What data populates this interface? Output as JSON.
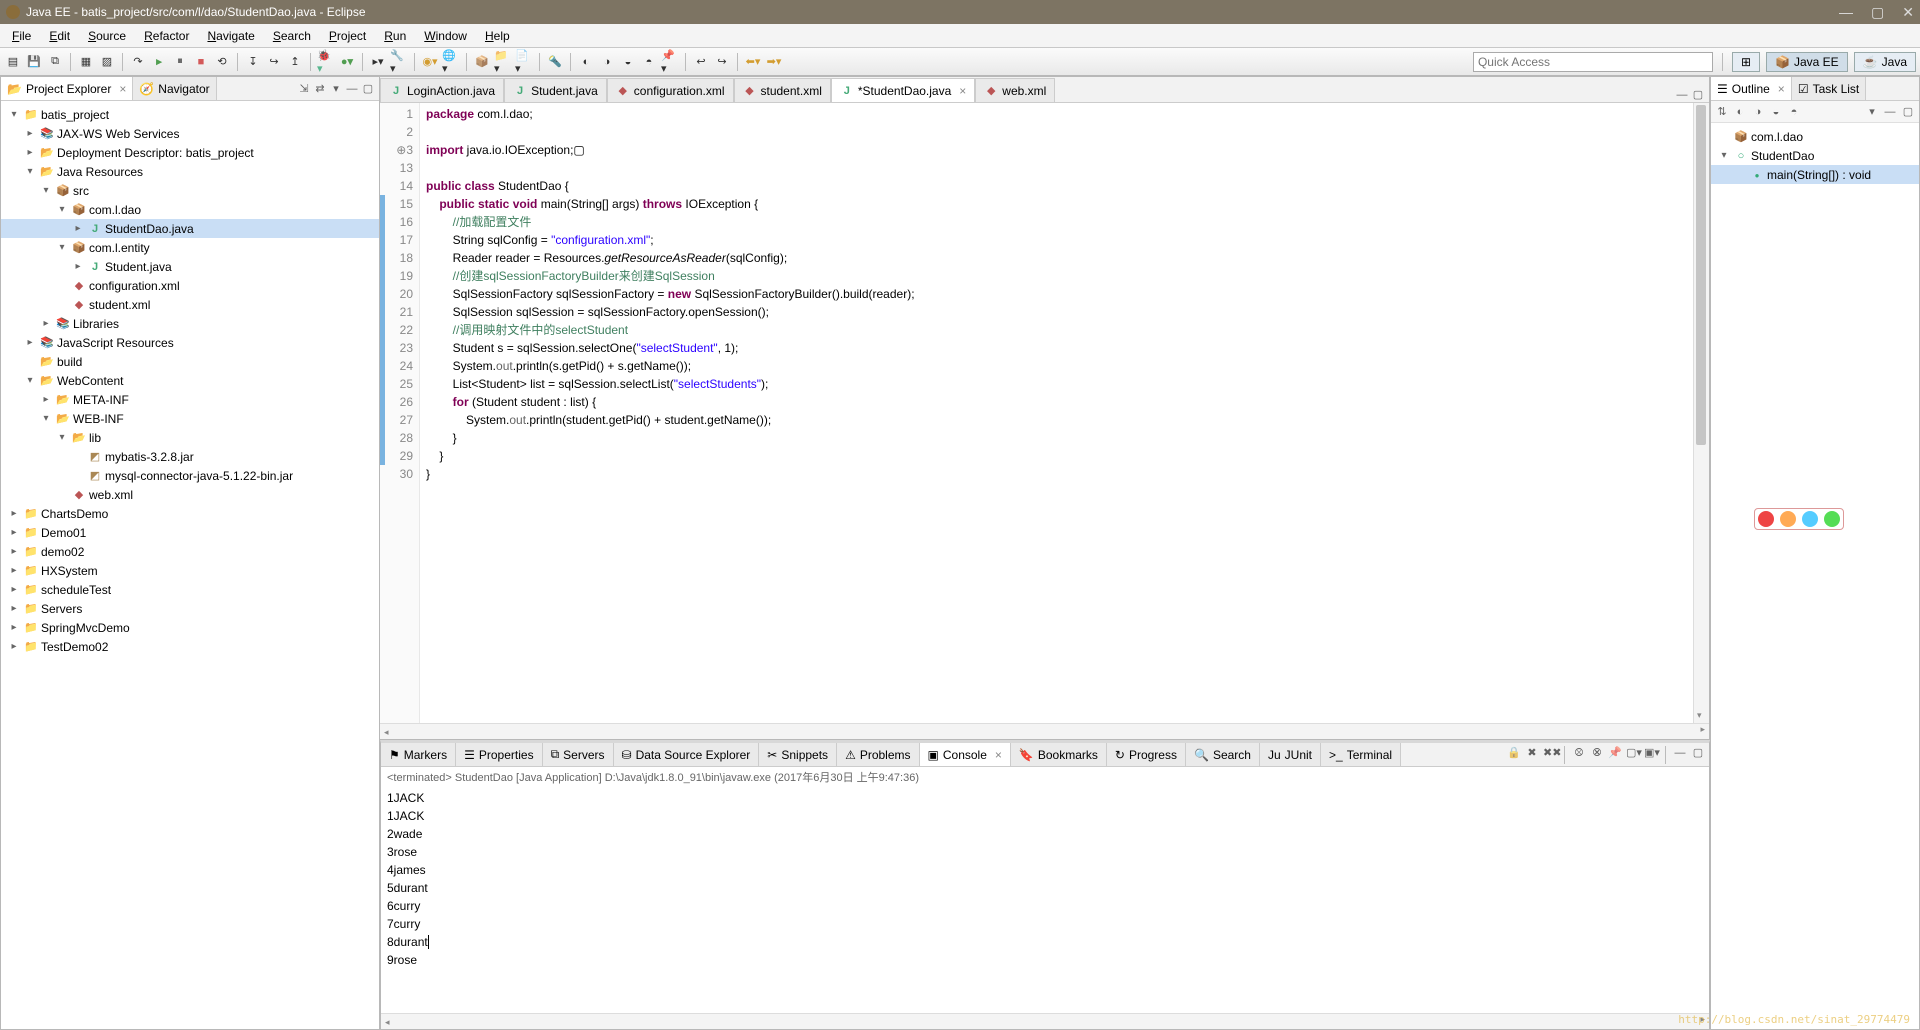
{
  "title": "Java EE - batis_project/src/com/l/dao/StudentDao.java - Eclipse",
  "menus": [
    "File",
    "Edit",
    "Source",
    "Refactor",
    "Navigate",
    "Search",
    "Project",
    "Run",
    "Window",
    "Help"
  ],
  "quick_access_ph": "Quick Access",
  "perspectives": [
    "Java EE",
    "Java"
  ],
  "left_tabs": {
    "a": "Project Explorer",
    "b": "Navigator"
  },
  "project_tree": [
    {
      "d": 0,
      "tw": "▾",
      "i": "ico-prj",
      "t": "batis_project"
    },
    {
      "d": 1,
      "tw": "▸",
      "i": "ico-lib",
      "t": "JAX-WS Web Services"
    },
    {
      "d": 1,
      "tw": "▸",
      "i": "ico-fld",
      "t": "Deployment Descriptor: batis_project"
    },
    {
      "d": 1,
      "tw": "▾",
      "i": "ico-fld",
      "t": "Java Resources"
    },
    {
      "d": 2,
      "tw": "▾",
      "i": "ico-pkg",
      "t": "src"
    },
    {
      "d": 3,
      "tw": "▾",
      "i": "ico-pkg",
      "t": "com.l.dao"
    },
    {
      "d": 4,
      "tw": "▸",
      "i": "ico-java",
      "t": "StudentDao.java",
      "sel": true
    },
    {
      "d": 3,
      "tw": "▾",
      "i": "ico-pkg",
      "t": "com.l.entity"
    },
    {
      "d": 4,
      "tw": "▸",
      "i": "ico-java",
      "t": "Student.java"
    },
    {
      "d": 3,
      "tw": " ",
      "i": "ico-xml",
      "t": "configuration.xml"
    },
    {
      "d": 3,
      "tw": " ",
      "i": "ico-xml",
      "t": "student.xml"
    },
    {
      "d": 2,
      "tw": "▸",
      "i": "ico-lib",
      "t": "Libraries"
    },
    {
      "d": 1,
      "tw": "▸",
      "i": "ico-lib",
      "t": "JavaScript Resources"
    },
    {
      "d": 1,
      "tw": " ",
      "i": "ico-fld",
      "t": "build"
    },
    {
      "d": 1,
      "tw": "▾",
      "i": "ico-fld",
      "t": "WebContent"
    },
    {
      "d": 2,
      "tw": "▸",
      "i": "ico-fld",
      "t": "META-INF"
    },
    {
      "d": 2,
      "tw": "▾",
      "i": "ico-fld",
      "t": "WEB-INF"
    },
    {
      "d": 3,
      "tw": "▾",
      "i": "ico-fld",
      "t": "lib"
    },
    {
      "d": 4,
      "tw": " ",
      "i": "ico-jar",
      "t": "mybatis-3.2.8.jar"
    },
    {
      "d": 4,
      "tw": " ",
      "i": "ico-jar",
      "t": "mysql-connector-java-5.1.22-bin.jar"
    },
    {
      "d": 3,
      "tw": " ",
      "i": "ico-xml",
      "t": "web.xml"
    },
    {
      "d": 0,
      "tw": "▸",
      "i": "ico-prj",
      "t": "ChartsDemo"
    },
    {
      "d": 0,
      "tw": "▸",
      "i": "ico-prj",
      "t": "Demo01"
    },
    {
      "d": 0,
      "tw": "▸",
      "i": "ico-prj",
      "t": "demo02"
    },
    {
      "d": 0,
      "tw": "▸",
      "i": "ico-prj",
      "t": "HXSystem"
    },
    {
      "d": 0,
      "tw": "▸",
      "i": "ico-prj",
      "t": "scheduleTest"
    },
    {
      "d": 0,
      "tw": "▸",
      "i": "ico-prj",
      "t": "Servers"
    },
    {
      "d": 0,
      "tw": "▸",
      "i": "ico-prj",
      "t": "SpringMvcDemo"
    },
    {
      "d": 0,
      "tw": "▸",
      "i": "ico-prj",
      "t": "TestDemo02"
    }
  ],
  "editor_tabs": [
    {
      "n": "LoginAction.java",
      "i": "ico-java"
    },
    {
      "n": "Student.java",
      "i": "ico-java"
    },
    {
      "n": "configuration.xml",
      "i": "ico-xml"
    },
    {
      "n": "student.xml",
      "i": "ico-xml"
    },
    {
      "n": "*StudentDao.java",
      "i": "ico-java",
      "active": true,
      "close": true
    },
    {
      "n": "web.xml",
      "i": "ico-xml"
    }
  ],
  "code": [
    {
      "n": 1,
      "h": "<span class='kw'>package</span> com.l.dao;"
    },
    {
      "n": 2,
      "h": ""
    },
    {
      "n": 3,
      "pre": "⊕",
      "h": "<span class='kw'>import</span> java.io.IOException;▢"
    },
    {
      "n": 13,
      "h": ""
    },
    {
      "n": 14,
      "h": "<span class='kw'>public class</span> StudentDao {"
    },
    {
      "n": 15,
      "hl": 1,
      "h": "    <span class='kw'>public static void</span> main(String[] args) <span class='kw'>throws</span> IOException {"
    },
    {
      "n": 16,
      "hl": 1,
      "h": "        <span class='cmt'>//加载配置文件</span>"
    },
    {
      "n": 17,
      "hl": 1,
      "h": "        String sqlConfig = <span class='str'>\"configuration.xml\"</span>;"
    },
    {
      "n": 18,
      "hl": 1,
      "h": "        Reader reader = Resources.<span class='fn'>getResourceAsReader</span>(sqlConfig);"
    },
    {
      "n": 19,
      "hl": 1,
      "h": "        <span class='cmt'>//创建sqlSessionFactoryBuilder来创建SqlSession</span>"
    },
    {
      "n": 20,
      "hl": 1,
      "h": "        SqlSessionFactory sqlSessionFactory = <span class='kw'>new</span> SqlSessionFactoryBuilder().build(reader);"
    },
    {
      "n": 21,
      "hl": 1,
      "h": "        SqlSession sqlSession = sqlSessionFactory.openSession();"
    },
    {
      "n": 22,
      "hl": 1,
      "h": "        <span class='cmt'>//调用映射文件中的selectStudent</span>"
    },
    {
      "n": 23,
      "hl": 1,
      "h": "        Student s = sqlSession.selectOne(<span class='str'>\"selectStudent\"</span>, 1);"
    },
    {
      "n": 24,
      "hl": 1,
      "h": "        System.<span class='ann'>out</span>.println(s.getPid() + s.getName());"
    },
    {
      "n": 25,
      "hl": 1,
      "h": "        List&lt;Student&gt; list = sqlSession.selectList(<span class='str'>\"selectStudents\"</span>);"
    },
    {
      "n": 26,
      "hl": 1,
      "h": "        <span class='kw'>for</span> (Student student : list) {"
    },
    {
      "n": 27,
      "hl": 1,
      "h": "            System.<span class='ann'>out</span>.println(student.getPid() + student.getName());"
    },
    {
      "n": 28,
      "hl": 1,
      "h": "        }"
    },
    {
      "n": 29,
      "hl": 1,
      "h": "    }"
    },
    {
      "n": 30,
      "h": "}"
    }
  ],
  "bottom_tabs": [
    {
      "n": "Markers",
      "i": "⚑"
    },
    {
      "n": "Properties",
      "i": "☰"
    },
    {
      "n": "Servers",
      "i": "⧉"
    },
    {
      "n": "Data Source Explorer",
      "i": "⛁"
    },
    {
      "n": "Snippets",
      "i": "✂"
    },
    {
      "n": "Problems",
      "i": "⚠"
    },
    {
      "n": "Console",
      "i": "▣",
      "active": true,
      "close": true
    },
    {
      "n": "Bookmarks",
      "i": "🔖"
    },
    {
      "n": "Progress",
      "i": "↻"
    },
    {
      "n": "Search",
      "i": "🔍"
    },
    {
      "n": "JUnit",
      "i": "Ju"
    },
    {
      "n": "Terminal",
      "i": ">_"
    }
  ],
  "console_header": "<terminated> StudentDao [Java Application] D:\\Java\\jdk1.8.0_91\\bin\\javaw.exe (2017年6月30日 上午9:47:36)",
  "console_lines": [
    "1JACK",
    "1JACK",
    "2wade",
    "3rose",
    "4james",
    "5durant",
    "6curry",
    "7curry",
    "8durant",
    "9rose"
  ],
  "right_tabs": {
    "a": "Outline",
    "b": "Task List"
  },
  "outline": [
    {
      "d": 0,
      "tw": " ",
      "i": "ico-pkg",
      "t": "com.l.dao"
    },
    {
      "d": 0,
      "tw": "▾",
      "i": "ico-class",
      "t": "StudentDao"
    },
    {
      "d": 1,
      "tw": " ",
      "i": "ico-method",
      "t": "main(String[]) : void",
      "sel": true
    }
  ],
  "watermark": "http://blog.csdn.net/sinat_29774479"
}
